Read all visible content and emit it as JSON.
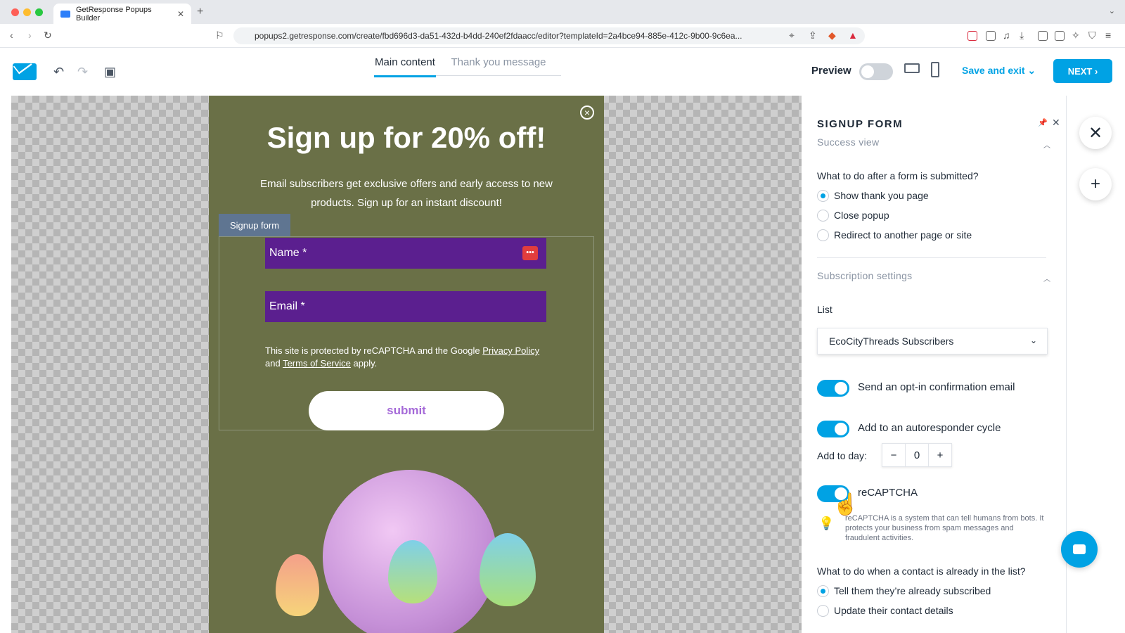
{
  "browser": {
    "tab_title": "GetResponse Popups Builder",
    "url": "popups2.getresponse.com/create/fbd696d3-da51-432d-b4dd-240ef2fdaacc/editor?templateId=2a4bce94-885e-412c-9b00-9c6ea..."
  },
  "header": {
    "tabs": [
      "Main content",
      "Thank you message"
    ],
    "preview_label": "Preview",
    "save_exit_label": "Save and exit",
    "next_label": "NEXT"
  },
  "popup": {
    "headline": "Sign up for 20% off!",
    "subtext": "Email subscribers get exclusive offers and early access to new products. Sign up for an instant discount!",
    "form_tag": "Signup form",
    "name_placeholder": "Name *",
    "email_placeholder": "Email *",
    "recaptcha_text_1": "This site is protected by reCAPTCHA and the Google ",
    "privacy_link": "Privacy Policy",
    "recaptcha_text_2": " and ",
    "terms_link": "Terms of Service",
    "recaptcha_text_3": " apply.",
    "submit_label": "submit"
  },
  "panel": {
    "title": "SIGNUP FORM",
    "success_view": "Success view",
    "after_submit_question": "What to do after a form is submitted?",
    "after_submit_options": [
      "Show thank you page",
      "Close popup",
      "Redirect to another page or site"
    ],
    "after_submit_selected": 0,
    "subscription_settings": "Subscription settings",
    "list_label": "List",
    "list_value": "EcoCityThreads Subscribers",
    "toggle_optin": "Send an opt-in confirmation email",
    "toggle_autoresponder": "Add to an autoresponder cycle",
    "add_to_day_label": "Add to day:",
    "add_to_day_value": "0",
    "recaptcha_label": "reCAPTCHA",
    "recaptcha_hint": "reCAPTCHA is a system that can tell humans from bots. It protects your business from spam messages and fraudulent activities.",
    "existing_contact_question": "What to do when a contact is already in the list?",
    "existing_contact_options": [
      "Tell them they’re already subscribed",
      "Update their contact details"
    ],
    "existing_contact_selected": 0
  },
  "colors": {
    "accent": "#00a2e4",
    "popup_bg": "#6a7047",
    "field_bg": "#5b1f8f",
    "submit_text": "#a56ad8"
  }
}
